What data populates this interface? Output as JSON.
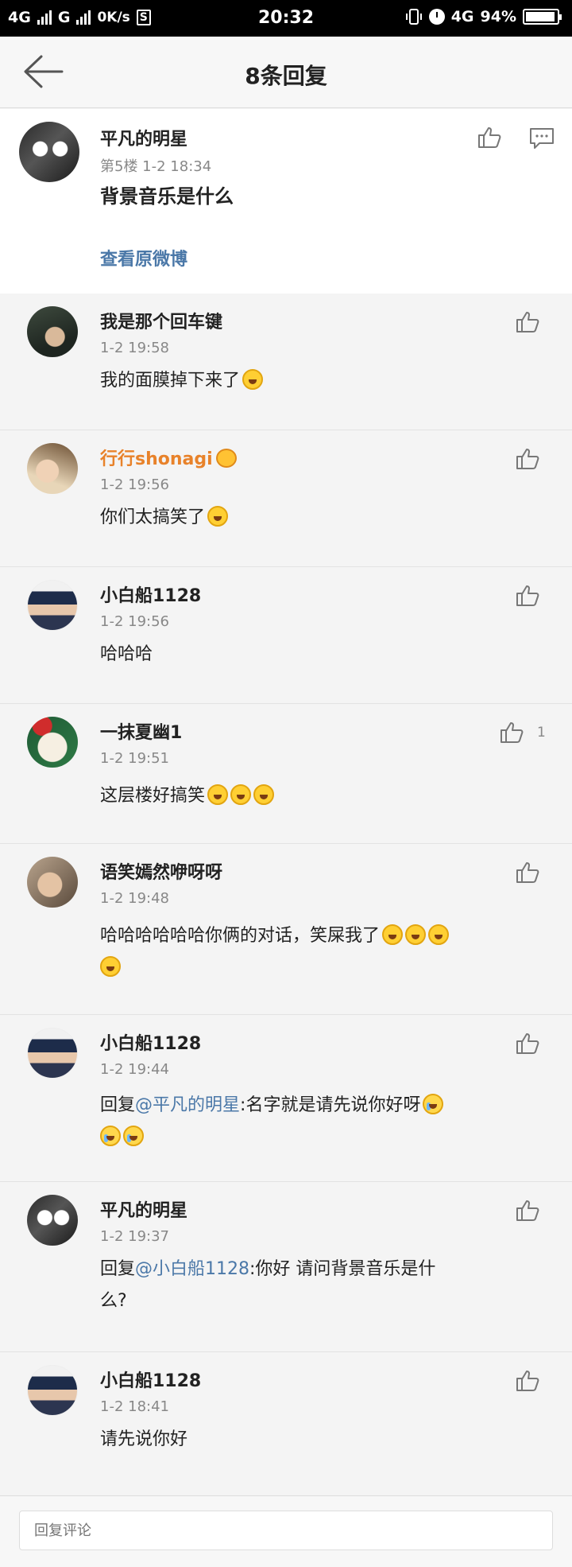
{
  "status_bar": {
    "network1": "4G",
    "network2": "G",
    "speed": "0K/s",
    "sim_label": "S",
    "time": "20:32",
    "network3": "4G",
    "battery_text": "94%",
    "battery_level": 0.94
  },
  "header": {
    "title": "8条回复"
  },
  "original": {
    "name": "平凡的明星",
    "meta": "第5楼 1-2 18:34",
    "text": "背景音乐是什么",
    "view_link": "查看原微博"
  },
  "replies": [
    {
      "name": "我是那个回车键",
      "time": "1-2 19:58",
      "text": "我的面膜掉下来了",
      "emojis": 1
    },
    {
      "name": "行行shonagi",
      "time": "1-2 19:56",
      "text": "你们太搞笑了",
      "emojis": 1
    },
    {
      "name": "小白船1128",
      "time": "1-2 19:56",
      "text": "哈哈哈"
    },
    {
      "name": "一抹夏幽1",
      "time": "1-2 19:51",
      "text": "这层楼好搞笑",
      "like_count": "1"
    },
    {
      "name": "语笑嫣然咿呀呀",
      "time": "1-2 19:48",
      "text": "哈哈哈哈哈哈你俩的对话，笑屎我了"
    },
    {
      "name": "小白船1128",
      "time": "1-2 19:44",
      "reply_prefix": "回复",
      "mention": "@平凡的明星",
      "text": ":名字就是请先说你好呀"
    },
    {
      "name": "平凡的明星",
      "time": "1-2 19:37",
      "reply_prefix": "回复",
      "mention": "@小白船1128",
      "text_line1": ":你好 请问背景音乐是什",
      "text_line2": "么?"
    },
    {
      "name": "小白船1128",
      "time": "1-2 18:41",
      "text": "请先说你好"
    }
  ],
  "input": {
    "placeholder": "回复评论"
  }
}
